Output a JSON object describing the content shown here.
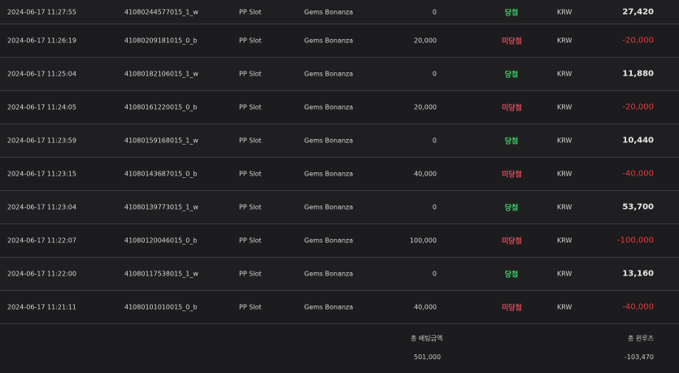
{
  "rows": [
    {
      "time": "2024-06-17 11:27:55",
      "id": "41080244577015_1_w",
      "category": "PP Slot",
      "game": "Gems Bonanza",
      "bet": "0",
      "result": "당첨",
      "currency": "KRW",
      "amount": "27,420"
    },
    {
      "time": "2024-06-17 11:26:19",
      "id": "41080209181015_0_b",
      "category": "PP Slot",
      "game": "Gems Bonanza",
      "bet": "20,000",
      "result": "미당첨",
      "currency": "KRW",
      "amount": "-20,000"
    },
    {
      "time": "2024-06-17 11:25:04",
      "id": "41080182106015_1_w",
      "category": "PP Slot",
      "game": "Gems Bonanza",
      "bet": "0",
      "result": "당첨",
      "currency": "KRW",
      "amount": "11,880"
    },
    {
      "time": "2024-06-17 11:24:05",
      "id": "41080161220015_0_b",
      "category": "PP Slot",
      "game": "Gems Bonanza",
      "bet": "20,000",
      "result": "미당첨",
      "currency": "KRW",
      "amount": "-20,000"
    },
    {
      "time": "2024-06-17 11:23:59",
      "id": "41080159168015_1_w",
      "category": "PP Slot",
      "game": "Gems Bonanza",
      "bet": "0",
      "result": "당첨",
      "currency": "KRW",
      "amount": "10,440"
    },
    {
      "time": "2024-06-17 11:23:15",
      "id": "41080143687015_0_b",
      "category": "PP Slot",
      "game": "Gems Bonanza",
      "bet": "40,000",
      "result": "미당첨",
      "currency": "KRW",
      "amount": "-40,000"
    },
    {
      "time": "2024-06-17 11:23:04",
      "id": "41080139773015_1_w",
      "category": "PP Slot",
      "game": "Gems Bonanza",
      "bet": "0",
      "result": "당첨",
      "currency": "KRW",
      "amount": "53,700"
    },
    {
      "time": "2024-06-17 11:22:07",
      "id": "41080120046015_0_b",
      "category": "PP Slot",
      "game": "Gems Bonanza",
      "bet": "100,000",
      "result": "미당첨",
      "currency": "KRW",
      "amount": "-100,000"
    },
    {
      "time": "2024-06-17 11:22:00",
      "id": "41080117538015_1_w",
      "category": "PP Slot",
      "game": "Gems Bonanza",
      "bet": "0",
      "result": "당첨",
      "currency": "KRW",
      "amount": "13,160"
    },
    {
      "time": "2024-06-17 11:21:11",
      "id": "41080101010015_0_b",
      "category": "PP Slot",
      "game": "Gems Bonanza",
      "bet": "40,000",
      "result": "미당첨",
      "currency": "KRW",
      "amount": "-40,000"
    }
  ],
  "footer": {
    "total_bet_label": "총 배팅금액",
    "total_bet_value": "501,000",
    "total_winloss_label": "총 윈루즈",
    "total_winloss_value": "-103,470"
  },
  "colors": {
    "win": "#3fd26a",
    "lose": "#e24a58",
    "negative": "#e23b3b",
    "background": "#1c1c1e"
  }
}
